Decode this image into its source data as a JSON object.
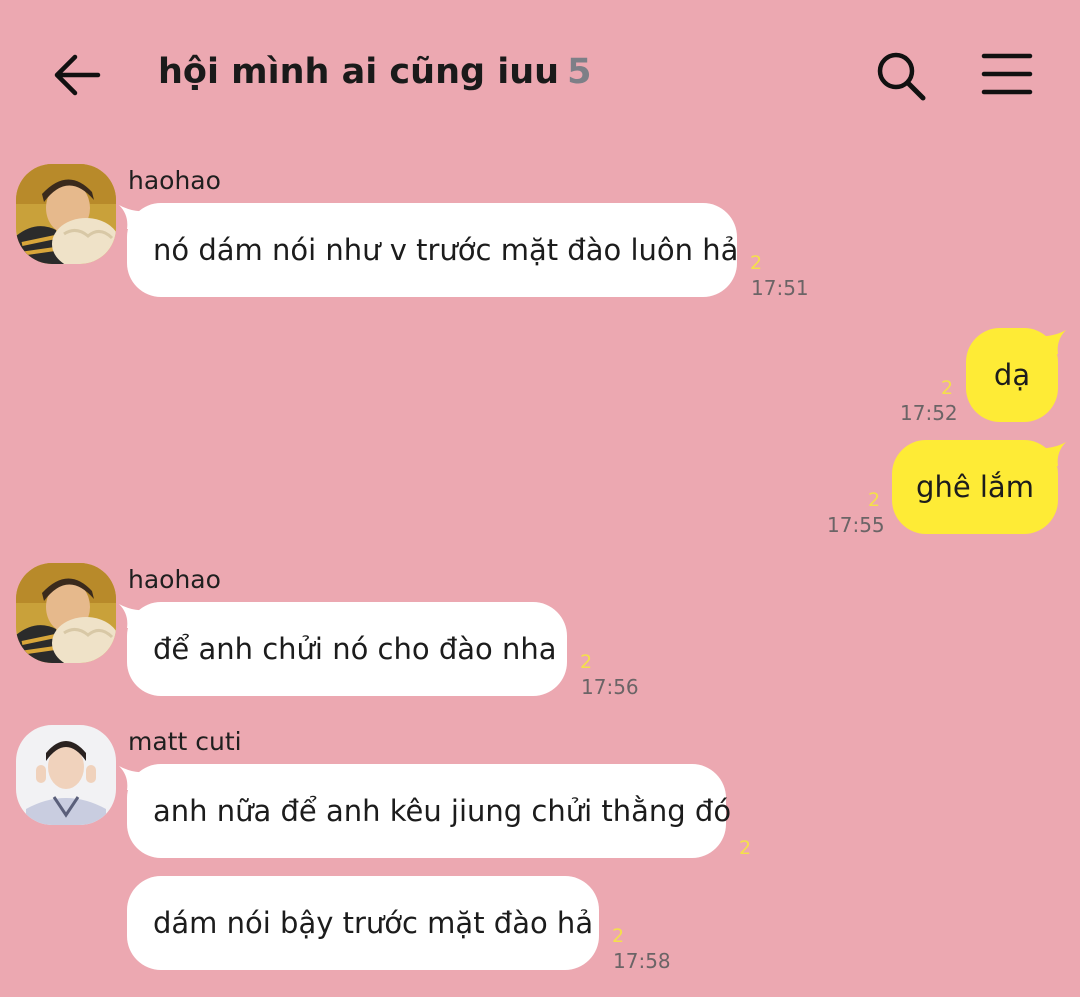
{
  "header": {
    "title": "hội mình ai cũng iuu",
    "member_count": "5",
    "back_icon": "arrow-left-icon",
    "search_icon": "search-icon",
    "menu_icon": "hamburger-menu-icon"
  },
  "colors": {
    "background": "#eca8b1",
    "incoming_bubble": "#ffffff",
    "outgoing_bubble": "#feeb36",
    "unread_count": "#f4e04a",
    "timestamp": "#6b6466"
  },
  "messages": [
    {
      "sender": "haohao",
      "text": "nó dám nói như v trước mặt đào luôn hả",
      "unread": "2",
      "time": "17:51",
      "direction": "incoming"
    },
    {
      "text": "dạ",
      "unread": "2",
      "time": "17:52",
      "direction": "outgoing"
    },
    {
      "text": "ghê lắm",
      "unread": "2",
      "time": "17:55",
      "direction": "outgoing"
    },
    {
      "sender": "haohao",
      "text": "để anh chửi nó cho đào nha",
      "unread": "2",
      "time": "17:56",
      "direction": "incoming"
    },
    {
      "sender": "matt cuti",
      "text": "anh nữa để anh kêu jiung chửi thằng đó",
      "unread": "2",
      "direction": "incoming"
    },
    {
      "text": "dám nói bậy trước mặt đào hả",
      "unread": "2",
      "time": "17:58",
      "direction": "incoming"
    }
  ]
}
